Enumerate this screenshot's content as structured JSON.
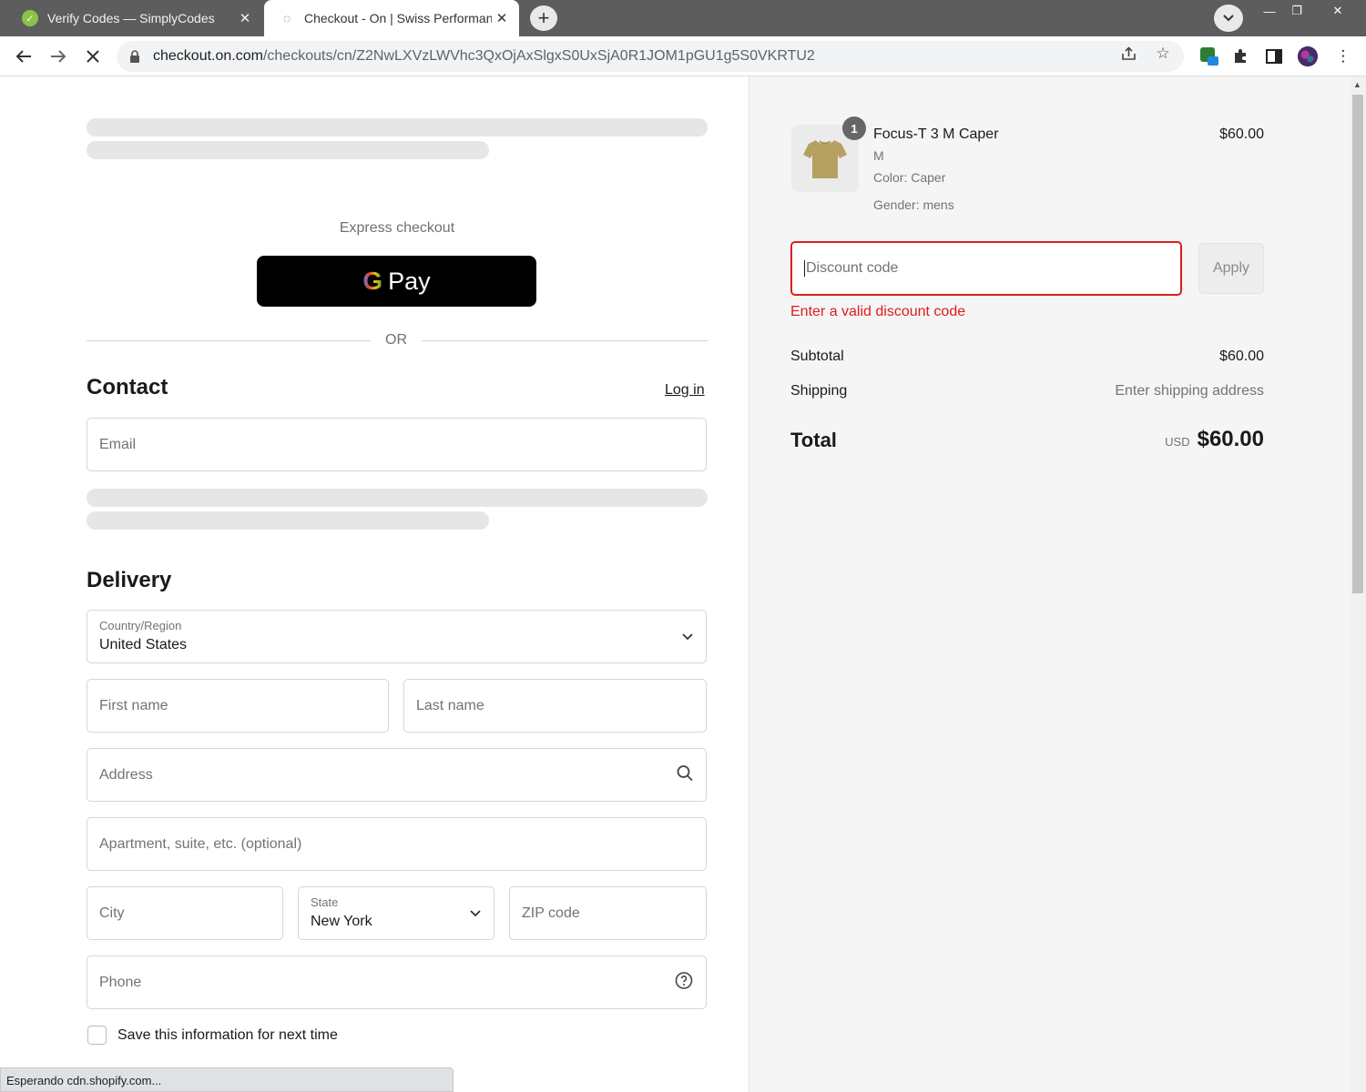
{
  "browser": {
    "tabs": [
      {
        "title": "Verify Codes — SimplyCodes",
        "close": "✕",
        "icon": "simplycodes-check-icon"
      },
      {
        "title": "Checkout - On | Swiss Performance",
        "close": "✕",
        "icon": "loading-spinner-icon"
      }
    ],
    "new_tab": "+",
    "url_host": "checkout.on.com",
    "url_path": "/checkouts/cn/Z2NwLXVzLWVhc3QxOjAxSlgxS0UxSjA0R1JOM1pGU1g5S0VKRTU2",
    "status_text": "Esperando cdn.shopify.com..."
  },
  "checkout": {
    "express_label": "Express checkout",
    "gpay_g": "G",
    "gpay_label": "Pay",
    "or_label": "OR",
    "contact_title": "Contact",
    "login_label": "Log in",
    "email_placeholder": "Email",
    "delivery_title": "Delivery",
    "country_label": "Country/Region",
    "country_value": "United States",
    "first_name_placeholder": "First name",
    "last_name_placeholder": "Last name",
    "address_placeholder": "Address",
    "apartment_placeholder": "Apartment, suite, etc. (optional)",
    "city_placeholder": "City",
    "state_label": "State",
    "state_value": "New York",
    "zip_placeholder": "ZIP code",
    "phone_placeholder": "Phone",
    "save_info_label": "Save this information for next time"
  },
  "summary": {
    "item": {
      "quantity": "1",
      "name": "Focus-T 3 M Caper",
      "size": "M",
      "color": "Color: Caper",
      "gender": "Gender: mens",
      "price": "$60.00"
    },
    "discount_placeholder": "Discount code",
    "apply_label": "Apply",
    "discount_error": "Enter a valid discount code",
    "subtotal_label": "Subtotal",
    "subtotal_value": "$60.00",
    "shipping_label": "Shipping",
    "shipping_value": "Enter shipping address",
    "total_label": "Total",
    "total_currency": "USD",
    "total_value": "$60.00"
  },
  "colors": {
    "error": "#dd1d1d",
    "tshirt": "#b5a062"
  }
}
